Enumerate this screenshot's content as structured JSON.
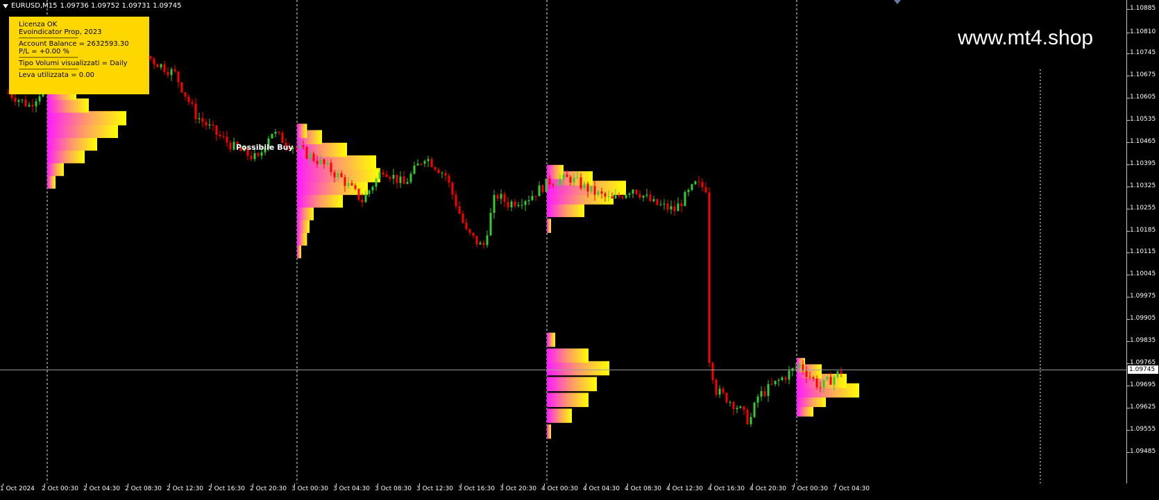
{
  "symbol_bar": {
    "symbol": "EURUSD,M15",
    "ohlc": "1.09736 1.09752 1.09731 1.09745"
  },
  "info_panel": {
    "lines": [
      "Licenza OK",
      "Evoindicator Prop, 2023",
      "---------------------------------------------",
      "Account Balance = 2632593.30",
      "P/L  = +0.00 %",
      "---------------------------------------------",
      "Tipo Volumi visualizzati = Daily",
      "---------------------------------------------",
      "Leva utilizzata = 0.00"
    ]
  },
  "watermark": "www.mt4.shop",
  "signal_label": "Possibile Buy",
  "colors": {
    "background": "#000000",
    "bull_candle": "#32cd32",
    "bear_candle": "#ff0000",
    "panel": "#ffd700",
    "profile_high": "#ff1aff",
    "profile_low": "#ffff00",
    "grid_separator": "#ffffff"
  },
  "price_axis": {
    "labels": [
      "1.10885",
      "1.10810",
      "1.10745",
      "1.10675",
      "1.10605",
      "1.10535",
      "1.10465",
      "1.10395",
      "1.10325",
      "1.10255",
      "1.10185",
      "1.10115",
      "1.10045",
      "1.09975",
      "1.09905",
      "1.09835",
      "1.09765",
      "1.09695",
      "1.09625",
      "1.09555",
      "1.09485"
    ],
    "current_price": "1.09745"
  },
  "time_axis": {
    "labels": [
      "1 Oct 2024",
      "2 Oct 00:30",
      "2 Oct 04:30",
      "2 Oct 08:30",
      "2 Oct 12:30",
      "2 Oct 16:30",
      "2 Oct 20:30",
      "3 Oct 00:30",
      "3 Oct 04:30",
      "3 Oct 08:30",
      "3 Oct 12:30",
      "3 Oct 16:30",
      "3 Oct 20:30",
      "4 Oct 00:30",
      "4 Oct 04:30",
      "4 Oct 08:30",
      "4 Oct 12:30",
      "4 Oct 16:30",
      "4 Oct 20:30",
      "7 Oct 00:30",
      "7 Oct 04:30"
    ]
  },
  "chart_data": {
    "type": "candlestick",
    "symbol": "EURUSD",
    "timeframe": "M15",
    "ylim": [
      1.09485,
      1.10885
    ],
    "current_price": 1.09745,
    "x": [
      "1 Oct 2024",
      "2 Oct 00:30",
      "2 Oct 04:30",
      "2 Oct 08:30",
      "2 Oct 12:30",
      "2 Oct 16:30",
      "2 Oct 20:30",
      "3 Oct 00:30",
      "3 Oct 04:30",
      "3 Oct 08:30",
      "3 Oct 12:30",
      "3 Oct 16:30",
      "3 Oct 20:30",
      "4 Oct 00:30",
      "4 Oct 04:30",
      "4 Oct 08:30",
      "4 Oct 12:30",
      "4 Oct 16:30",
      "4 Oct 20:30",
      "7 Oct 00:30",
      "7 Oct 04:30"
    ],
    "close_path": [
      [
        0,
        1.1062
      ],
      [
        0.5,
        1.1058
      ],
      [
        1,
        1.1066
      ],
      [
        1.5,
        1.1071
      ],
      [
        2,
        1.1074
      ],
      [
        2.5,
        1.1069
      ],
      [
        3,
        1.1077
      ],
      [
        3.5,
        1.1072
      ],
      [
        4,
        1.1068
      ],
      [
        4.5,
        1.1055
      ],
      [
        5,
        1.1049
      ],
      [
        5.5,
        1.1044
      ],
      [
        6,
        1.1041
      ],
      [
        6.3,
        1.105
      ],
      [
        6.6,
        1.1047
      ],
      [
        7,
        1.1044
      ],
      [
        7.5,
        1.104
      ],
      [
        8,
        1.1035
      ],
      [
        8.5,
        1.1028
      ],
      [
        9,
        1.1038
      ],
      [
        9.5,
        1.1033
      ],
      [
        10,
        1.1042
      ],
      [
        10.5,
        1.1036
      ],
      [
        11,
        1.1018
      ],
      [
        11.4,
        1.1013
      ],
      [
        11.7,
        1.103
      ],
      [
        12,
        1.1027
      ],
      [
        12.5,
        1.1029
      ],
      [
        13,
        1.1034
      ],
      [
        13.5,
        1.1035
      ],
      [
        14,
        1.1031
      ],
      [
        14.5,
        1.1028
      ],
      [
        15,
        1.1032
      ],
      [
        15.5,
        1.1027
      ],
      [
        16,
        1.1025
      ],
      [
        16.5,
        1.1033
      ],
      [
        16.75,
        1.1032
      ],
      [
        16.8,
        1.098
      ],
      [
        17,
        1.0968
      ],
      [
        17.5,
        1.0963
      ],
      [
        17.8,
        1.0958
      ],
      [
        18,
        1.0966
      ],
      [
        18.5,
        1.0971
      ],
      [
        19,
        1.0976
      ],
      [
        19.5,
        1.0969
      ],
      [
        20,
        1.0974
      ],
      [
        20.05,
        1.09745
      ]
    ],
    "session_separators": [
      1,
      7,
      13,
      19
    ],
    "annotations": [
      {
        "text": "Possibile Buy",
        "x": 6.0,
        "y": 1.10485
      }
    ],
    "volume_profiles": [
      {
        "session": "2 Oct",
        "x": 1,
        "price_range": [
          1.1034,
          1.1078
        ],
        "levels": [
          [
            1.1034,
            0.1
          ],
          [
            1.1038,
            0.2
          ],
          [
            1.1042,
            0.45
          ],
          [
            1.1046,
            0.6
          ],
          [
            1.105,
            0.85
          ],
          [
            1.1054,
            0.95
          ],
          [
            1.1058,
            0.5
          ],
          [
            1.1062,
            0.35
          ],
          [
            1.1066,
            0.2
          ],
          [
            1.107,
            0.3
          ],
          [
            1.1074,
            0.15
          ],
          [
            1.1078,
            0.08
          ]
        ]
      },
      {
        "session": "3 Oct",
        "x": 7,
        "price_range": [
          1.1012,
          1.105
        ],
        "levels": [
          [
            1.1012,
            0.05
          ],
          [
            1.1016,
            0.12
          ],
          [
            1.102,
            0.15
          ],
          [
            1.1024,
            0.2
          ],
          [
            1.1028,
            0.55
          ],
          [
            1.1032,
            0.85
          ],
          [
            1.1036,
            1.0
          ],
          [
            1.104,
            0.95
          ],
          [
            1.1044,
            0.6
          ],
          [
            1.1048,
            0.3
          ],
          [
            1.105,
            0.12
          ]
        ]
      },
      {
        "session": "4 Oct",
        "x": 13,
        "price_range": [
          1.0955,
          1.1037
        ],
        "levels": [
          [
            1.0955,
            0.05
          ],
          [
            1.096,
            0.3
          ],
          [
            1.0965,
            0.5
          ],
          [
            1.097,
            0.6
          ],
          [
            1.0975,
            0.75
          ],
          [
            1.0979,
            0.5
          ],
          [
            1.0984,
            0.1
          ],
          [
            1.102,
            0.05
          ],
          [
            1.1025,
            0.45
          ],
          [
            1.1029,
            0.8
          ],
          [
            1.1032,
            0.95
          ],
          [
            1.1035,
            0.55
          ],
          [
            1.1037,
            0.2
          ]
        ]
      },
      {
        "session": "7 Oct",
        "x": 19,
        "price_range": [
          1.0962,
          1.0976
        ],
        "levels": [
          [
            1.0962,
            0.2
          ],
          [
            1.0965,
            0.35
          ],
          [
            1.0968,
            0.75
          ],
          [
            1.0971,
            0.6
          ],
          [
            1.0974,
            0.3
          ],
          [
            1.0976,
            0.1
          ]
        ]
      }
    ]
  }
}
